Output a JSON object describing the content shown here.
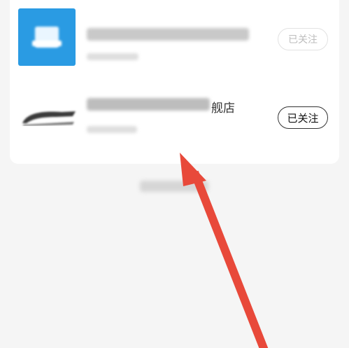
{
  "stores": [
    {
      "name_visible": "",
      "follow_label": "已关注",
      "logo": "blue-square-logo"
    },
    {
      "name_visible": "舰店",
      "follow_label": "已关注",
      "logo": "acer-logo"
    }
  ],
  "arrow_color": "#e8493a",
  "icons": [
    "blue-square-logo",
    "acer-logo",
    "red-arrow-annotation"
  ]
}
